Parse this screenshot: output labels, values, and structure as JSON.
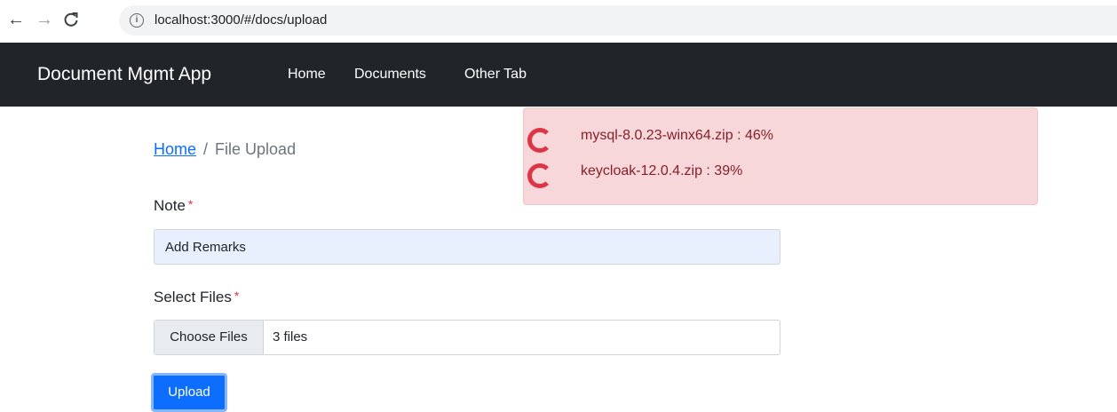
{
  "browser": {
    "back_icon": "←",
    "forward_icon": "→",
    "reload_icon": "C",
    "info_icon": "i",
    "url": "localhost:3000/#/docs/upload"
  },
  "navbar": {
    "brand": "Document Mgmt App",
    "links": [
      "Home",
      "Documents",
      "Other Tab"
    ]
  },
  "uploads": [
    {
      "text": "mysql-8.0.23-winx64.zip : 46%",
      "filename": "mysql-8.0.23-winx64.zip",
      "progress_percent": 46
    },
    {
      "text": "keycloak-12.0.4.zip : 39%",
      "filename": "keycloak-12.0.4.zip",
      "progress_percent": 39
    }
  ],
  "breadcrumb": {
    "home": "Home",
    "separator": "/",
    "current": "File Upload"
  },
  "form": {
    "note_label": "Note",
    "required_marker": "*",
    "note_value": "Add Remarks",
    "files_label": "Select Files",
    "choose_files": "Choose Files",
    "files_selected": "3 files",
    "upload_button": "Upload"
  },
  "colors": {
    "navbar_bg": "#212529",
    "toast_bg": "#f8d7da",
    "toast_text": "#842029",
    "spinner": "#dc3545",
    "primary": "#0d6efd",
    "required": "#dc3545"
  }
}
